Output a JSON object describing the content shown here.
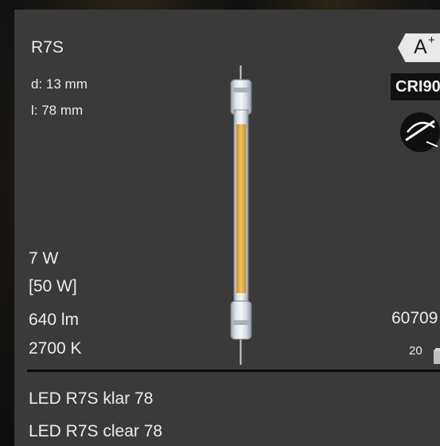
{
  "product": {
    "socket": "R7S",
    "diameter": "d: 13 mm",
    "length": "l:  78 mm",
    "wattage": "7 W",
    "equivalent_wattage": "[50 W]",
    "lumen": "640 lm",
    "color_temperature": "2700 K",
    "article_number": "60709",
    "pack_quantity": "20",
    "name_de": "LED R7S klar 78",
    "name_en": "LED R7S clear 78"
  },
  "badges": {
    "energy_class": "A",
    "energy_class_suffix": "+",
    "cri": "CRI90"
  },
  "icons": {
    "dimmable": "not-dimmable-icon",
    "package": "box-icon",
    "lamp": "r7s-lamp-image"
  },
  "colors": {
    "card_background": "#3a3a3a",
    "filament": "#e8b24a",
    "text": "#ececec"
  }
}
